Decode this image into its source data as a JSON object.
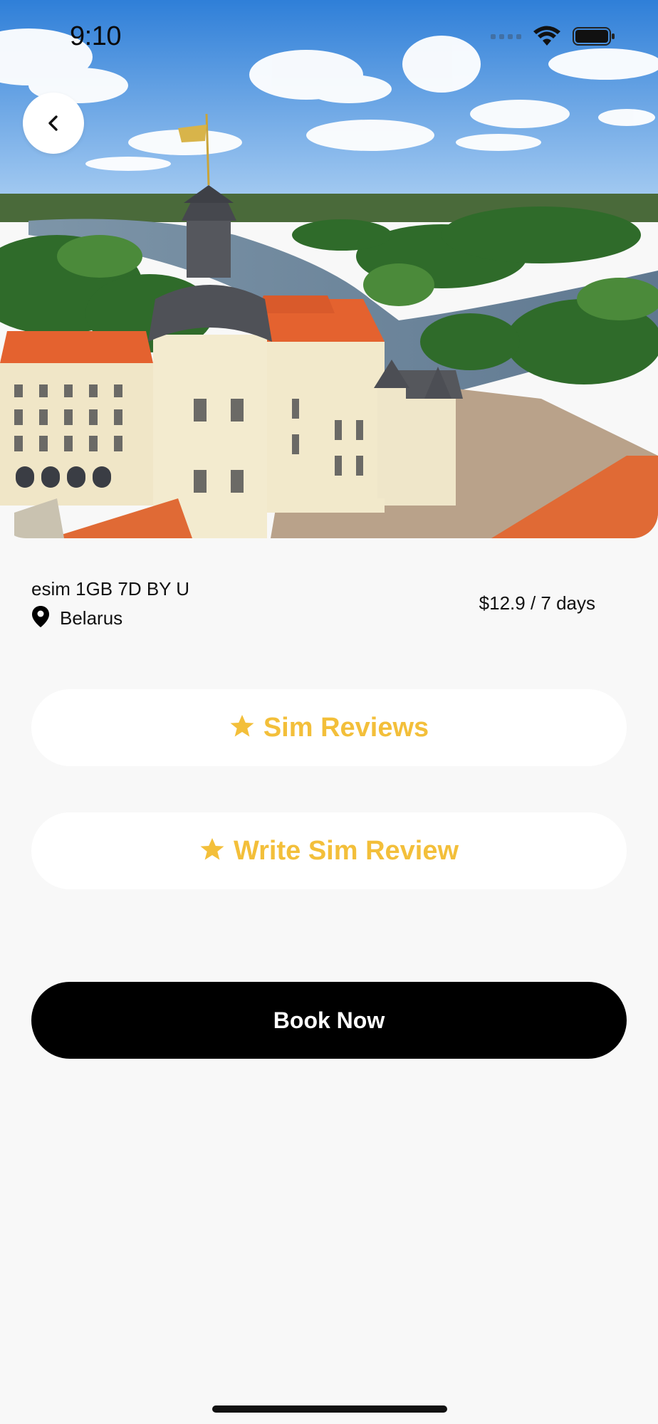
{
  "status_bar": {
    "time": "9:10"
  },
  "hero": {
    "image_subject": "aerial view of castle by river"
  },
  "product": {
    "name": "esim 1GB 7D BY U",
    "country": "Belarus",
    "price": "$12.9 / 7 days"
  },
  "buttons": {
    "reviews_label": "Sim Reviews",
    "write_review_label": "Write Sim Review",
    "book_label": "Book Now"
  },
  "colors": {
    "accent": "#f3bf3a",
    "primary_button": "#000000",
    "background": "#f8f8f8"
  },
  "icons": [
    "chevron-left-icon",
    "location-pin-icon",
    "star-icon",
    "wifi-icon",
    "battery-icon"
  ]
}
